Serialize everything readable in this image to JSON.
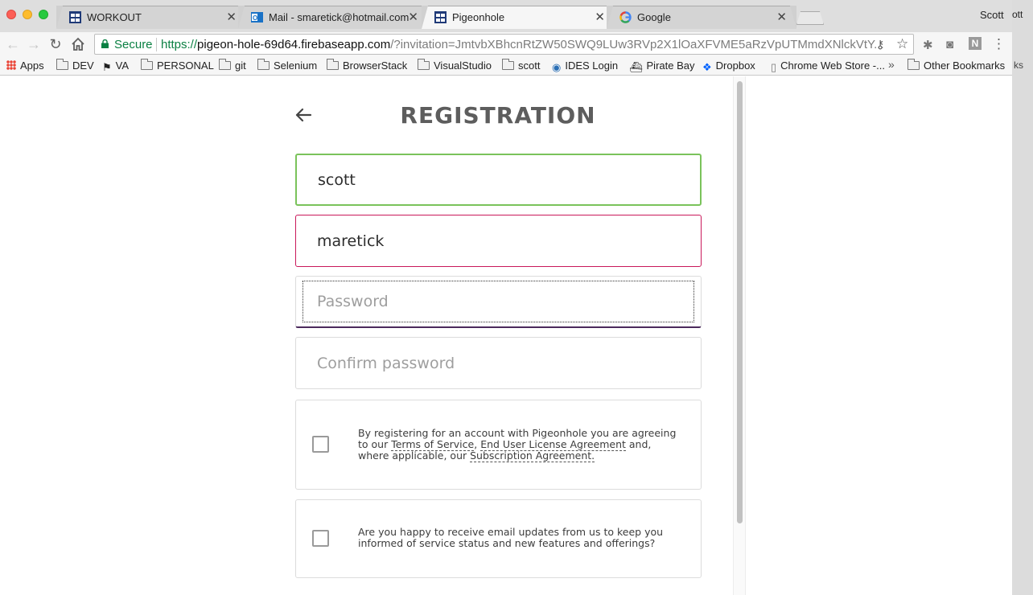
{
  "browser": {
    "tabs": [
      {
        "title": "WORKOUT",
        "close": "✕"
      },
      {
        "title": "Mail - smaretick@hotmail.com",
        "close": "✕"
      },
      {
        "title": "Pigeonhole",
        "close": "✕"
      },
      {
        "title": "Google",
        "close": "✕"
      }
    ],
    "profile_name": "Scott",
    "secure_label": "Secure",
    "url_scheme": "https://",
    "url_host": "pigeon-hole-69d64.firebaseapp.com",
    "url_rest": "/?invitation=JmtvbXBhcnRtZW50SWQ9LUw3RVp2X1lOaXFVME5aRzVpUTMmdXNlckVtY...",
    "bookmarks": [
      "Apps",
      "DEV",
      "VA",
      "PERSONAL",
      "git",
      "Selenium",
      "BrowserStack",
      "VisualStudio",
      "scott",
      "IDES Login",
      "Pirate Bay",
      "Dropbox",
      "Chrome Web Store -...",
      "Other Bookmarks"
    ],
    "more_bookmarks": "»",
    "ghost_text_top": "ott",
    "ghost_text_bm": "ks"
  },
  "registration": {
    "title": "REGISTRATION",
    "first_name_value": "scott",
    "last_name_value": "maretick",
    "password_placeholder": "Password",
    "confirm_placeholder": "Confirm password",
    "terms": {
      "prefix": "By registering for an account with Pigeonhole you are agreeing to our ",
      "tos_link": "Terms of Service",
      "sep1": ", ",
      "eula_link": "End User License Agreement",
      "middle": " and, where applicable, our ",
      "sub_link": "Subscription Agreement.",
      "checked": false
    },
    "email_updates": {
      "text": "Are you happy to receive email updates from us to keep you informed of service status and new features and offerings?",
      "checked": false
    }
  }
}
